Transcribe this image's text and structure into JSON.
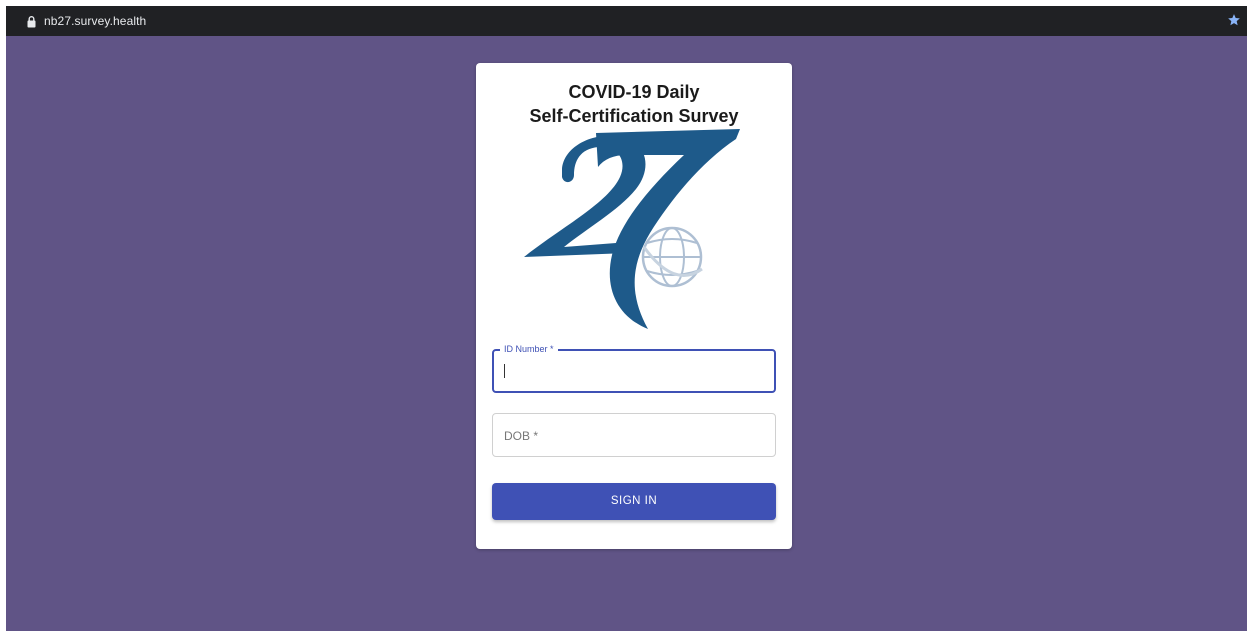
{
  "browser": {
    "url": "nb27.survey.health",
    "lock_icon": "lock-icon",
    "bookmark_icon": "star-icon"
  },
  "page": {
    "background_color": "#605486",
    "title_line1": "COVID-19 Daily",
    "title_line2": "Self-Certification Survey",
    "logo_icon": "nb27-logo"
  },
  "form": {
    "id_label": "ID Number *",
    "dob_label": "DOB *",
    "sign_in_label": "SIGN IN",
    "accent_color": "#3f51b5"
  }
}
